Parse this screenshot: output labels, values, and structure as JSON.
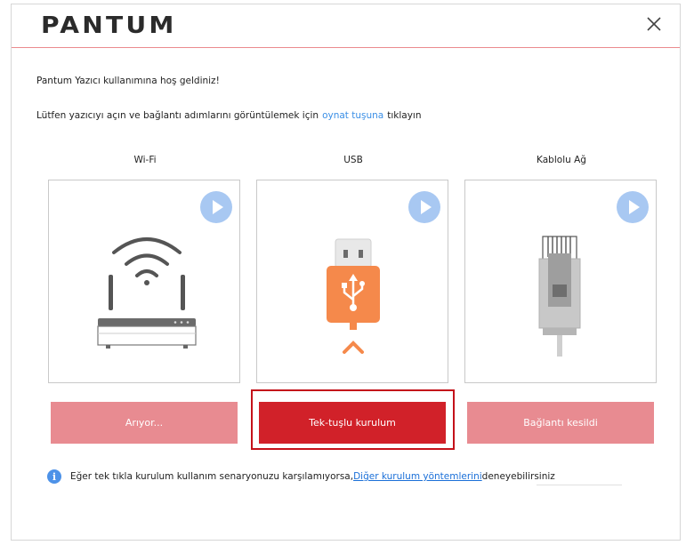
{
  "header": {
    "logo": "PANTUM"
  },
  "intro": {
    "welcome": "Pantum Yazıcı kullanımına hoş geldiniz!",
    "instruction_prefix": "Lütfen yazıcıyı açın ve bağlantı adımlarını görüntülemek için",
    "instruction_link": "oynat tuşuna",
    "instruction_suffix": "tıklayın"
  },
  "columns": [
    {
      "label": "Wi-Fi",
      "action": "Arıyor..."
    },
    {
      "label": "USB",
      "action": "Tek-tuşlu kurulum"
    },
    {
      "label": "Kablolu Ağ",
      "action": "Bağlantı kesildi"
    }
  ],
  "footer": {
    "info_icon": "i",
    "text_before": "Eğer tek tıkla kurulum kullanım senaryonuzu karşılamıyorsa,",
    "link": "Diğer kurulum yöntemlerini",
    "text_after": "deneyebilirsiniz"
  },
  "colors": {
    "accent": "#d12129",
    "accent_muted": "#e88b91",
    "link": "#3b8fe6",
    "play_button": "#a8c8f2",
    "usb_orange": "#f5894b"
  },
  "icons": {
    "close": "close-icon",
    "play": "play-icon",
    "wifi_router": "wifi-router-icon",
    "usb_drive": "usb-drive-icon",
    "ethernet": "ethernet-cable-icon",
    "info": "info-icon"
  }
}
